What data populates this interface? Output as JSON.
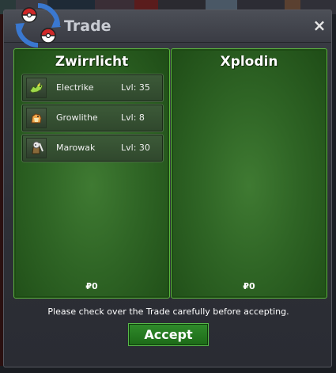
{
  "window": {
    "title": "Trade",
    "close_symbol": "×"
  },
  "trade": {
    "left": {
      "trainer": "Zwirrlicht",
      "money": "₽0",
      "pokemon": [
        {
          "name": "Electrike",
          "level": "Lvl: 35",
          "icon": "electrike-icon"
        },
        {
          "name": "Growlithe",
          "level": "Lvl: 8",
          "icon": "growlithe-icon"
        },
        {
          "name": "Marowak",
          "level": "Lvl: 30",
          "icon": "marowak-icon"
        }
      ]
    },
    "right": {
      "trainer": "Xplodin",
      "money": "₽0",
      "pokemon": []
    }
  },
  "footer": {
    "notice": "Please check over the Trade carefully before accepting.",
    "accept_label": "Accept"
  },
  "colors": {
    "panel_green": "#2f6525",
    "button_green": "#2f8a2a",
    "window_gray": "#2d2f36"
  }
}
